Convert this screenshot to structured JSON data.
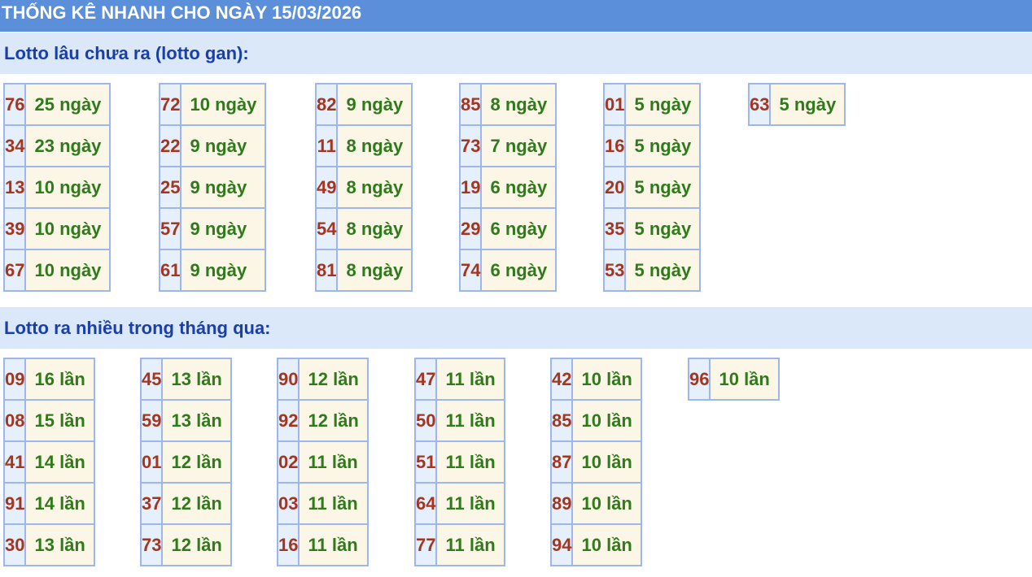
{
  "page": {
    "title": "THỐNG KÊ NHANH CHO NGÀY 15/03/2026"
  },
  "sections": [
    {
      "id": "gan",
      "heading": "Lotto lâu chưa ra (lotto gan):",
      "groups": [
        [
          {
            "num": "76",
            "value": "25 ngày"
          },
          {
            "num": "34",
            "value": "23 ngày"
          },
          {
            "num": "13",
            "value": "10 ngày"
          },
          {
            "num": "39",
            "value": "10 ngày"
          },
          {
            "num": "67",
            "value": "10 ngày"
          }
        ],
        [
          {
            "num": "72",
            "value": "10 ngày"
          },
          {
            "num": "22",
            "value": "9 ngày"
          },
          {
            "num": "25",
            "value": "9 ngày"
          },
          {
            "num": "57",
            "value": "9 ngày"
          },
          {
            "num": "61",
            "value": "9 ngày"
          }
        ],
        [
          {
            "num": "82",
            "value": "9 ngày"
          },
          {
            "num": "11",
            "value": "8 ngày"
          },
          {
            "num": "49",
            "value": "8 ngày"
          },
          {
            "num": "54",
            "value": "8 ngày"
          },
          {
            "num": "81",
            "value": "8 ngày"
          }
        ],
        [
          {
            "num": "85",
            "value": "8 ngày"
          },
          {
            "num": "73",
            "value": "7 ngày"
          },
          {
            "num": "19",
            "value": "6 ngày"
          },
          {
            "num": "29",
            "value": "6 ngày"
          },
          {
            "num": "74",
            "value": "6 ngày"
          }
        ],
        [
          {
            "num": "01",
            "value": "5 ngày"
          },
          {
            "num": "16",
            "value": "5 ngày"
          },
          {
            "num": "20",
            "value": "5 ngày"
          },
          {
            "num": "35",
            "value": "5 ngày"
          },
          {
            "num": "53",
            "value": "5 ngày"
          }
        ],
        [
          {
            "num": "63",
            "value": "5 ngày"
          }
        ]
      ]
    },
    {
      "id": "frequent",
      "heading": "Lotto ra nhiều trong tháng qua:",
      "groups": [
        [
          {
            "num": "09",
            "value": "16 lần"
          },
          {
            "num": "08",
            "value": "15 lần"
          },
          {
            "num": "41",
            "value": "14 lần"
          },
          {
            "num": "91",
            "value": "14 lần"
          },
          {
            "num": "30",
            "value": "13 lần"
          }
        ],
        [
          {
            "num": "45",
            "value": "13 lần"
          },
          {
            "num": "59",
            "value": "13 lần"
          },
          {
            "num": "01",
            "value": "12 lần"
          },
          {
            "num": "37",
            "value": "12 lần"
          },
          {
            "num": "73",
            "value": "12 lần"
          }
        ],
        [
          {
            "num": "90",
            "value": "12 lần"
          },
          {
            "num": "92",
            "value": "12 lần"
          },
          {
            "num": "02",
            "value": "11 lần"
          },
          {
            "num": "03",
            "value": "11 lần"
          },
          {
            "num": "16",
            "value": "11 lần"
          }
        ],
        [
          {
            "num": "47",
            "value": "11 lần"
          },
          {
            "num": "50",
            "value": "11 lần"
          },
          {
            "num": "51",
            "value": "11 lần"
          },
          {
            "num": "64",
            "value": "11 lần"
          },
          {
            "num": "77",
            "value": "11 lần"
          }
        ],
        [
          {
            "num": "42",
            "value": "10 lần"
          },
          {
            "num": "85",
            "value": "10 lần"
          },
          {
            "num": "87",
            "value": "10 lần"
          },
          {
            "num": "89",
            "value": "10 lần"
          },
          {
            "num": "94",
            "value": "10 lần"
          }
        ],
        [
          {
            "num": "96",
            "value": "10 lần"
          }
        ]
      ]
    }
  ]
}
